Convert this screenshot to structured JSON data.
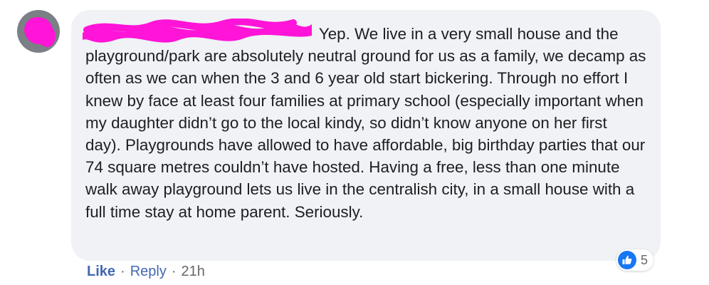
{
  "comment": {
    "author_name": "",
    "text": "Yep. We live in a very small house and the playground/park are absolutely neutral ground for us as a family, we decamp as often as we can when the 3 and 6 year old start bickering. Through no effort I knew by face at least four families at primary school (especially important when my daughter didn’t go to the local kindy, so didn’t know anyone on her first day). Playgrounds have allowed to have affordable, big birthday parties that our 74 square metres couldn’t have hosted. Having a free, less than one minute walk away playground lets us live in the centralish city, in a small house with a full time stay at home parent. Seriously."
  },
  "actions": {
    "like_label": "Like",
    "separator": "·",
    "reply_label": "Reply",
    "timestamp": "21h"
  },
  "reactions": {
    "icon": "thumbs-up-icon",
    "count": "5"
  },
  "colors": {
    "bubble_bg": "#f0f2f5",
    "link_blue": "#4267b2",
    "like_blue": "#1877f2",
    "redaction_magenta": "#ff14d8",
    "muted_text": "#65676b"
  }
}
